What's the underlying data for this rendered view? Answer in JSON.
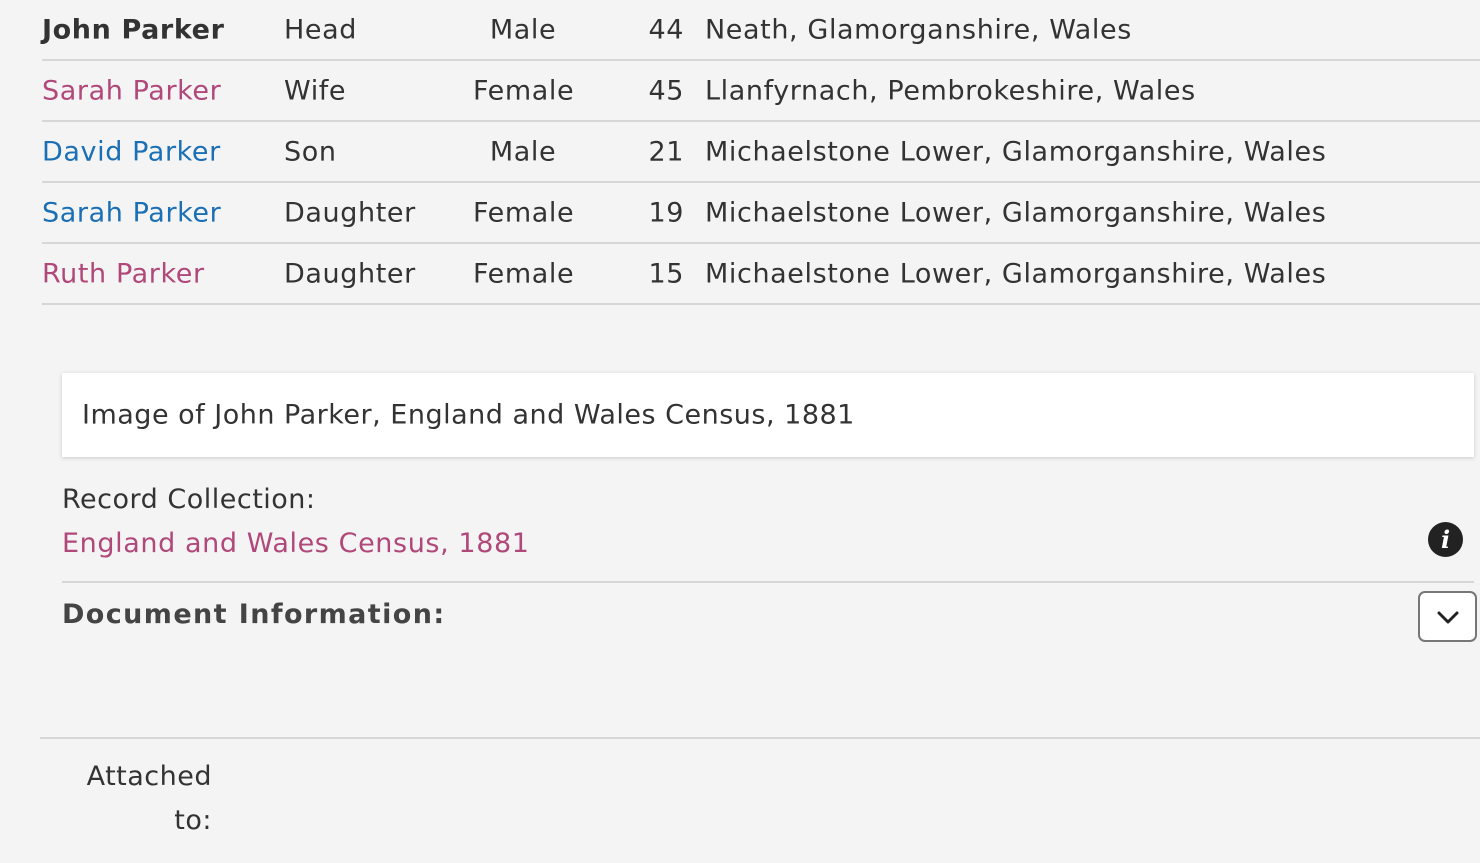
{
  "household": {
    "members": [
      {
        "name": "John Parker",
        "relationship": "Head",
        "gender": "Male",
        "age": "44",
        "birthplace": "Neath, Glamorganshire, Wales",
        "style": "self"
      },
      {
        "name": "Sarah Parker",
        "relationship": "Wife",
        "gender": "Female",
        "age": "45",
        "birthplace": "Llanfyrnach, Pembrokeshire, Wales",
        "style": "female"
      },
      {
        "name": "David Parker",
        "relationship": "Son",
        "gender": "Male",
        "age": "21",
        "birthplace": "Michaelstone Lower, Glamorganshire, Wales",
        "style": "male"
      },
      {
        "name": "Sarah Parker",
        "relationship": "Daughter",
        "gender": "Female",
        "age": "19",
        "birthplace": "Michaelstone Lower, Glamorganshire, Wales",
        "style": "male"
      },
      {
        "name": "Ruth Parker",
        "relationship": "Daughter",
        "gender": "Female",
        "age": "15",
        "birthplace": "Michaelstone Lower, Glamorganshire, Wales",
        "style": "female"
      }
    ]
  },
  "image_card": {
    "text": "Image of John Parker, England and Wales Census, 1881"
  },
  "record_collection": {
    "label": "Record Collection:",
    "link_text": "England and Wales Census, 1881",
    "info_icon": "info-icon"
  },
  "document_information": {
    "label": "Document Information:",
    "toggle_icon": "chevron-down-icon"
  },
  "attached": {
    "label": "Attached to:"
  },
  "colors": {
    "female_link": "#b0487a",
    "male_link": "#1a6fb5",
    "background": "#f4f4f4",
    "divider": "#d7d7d7"
  }
}
